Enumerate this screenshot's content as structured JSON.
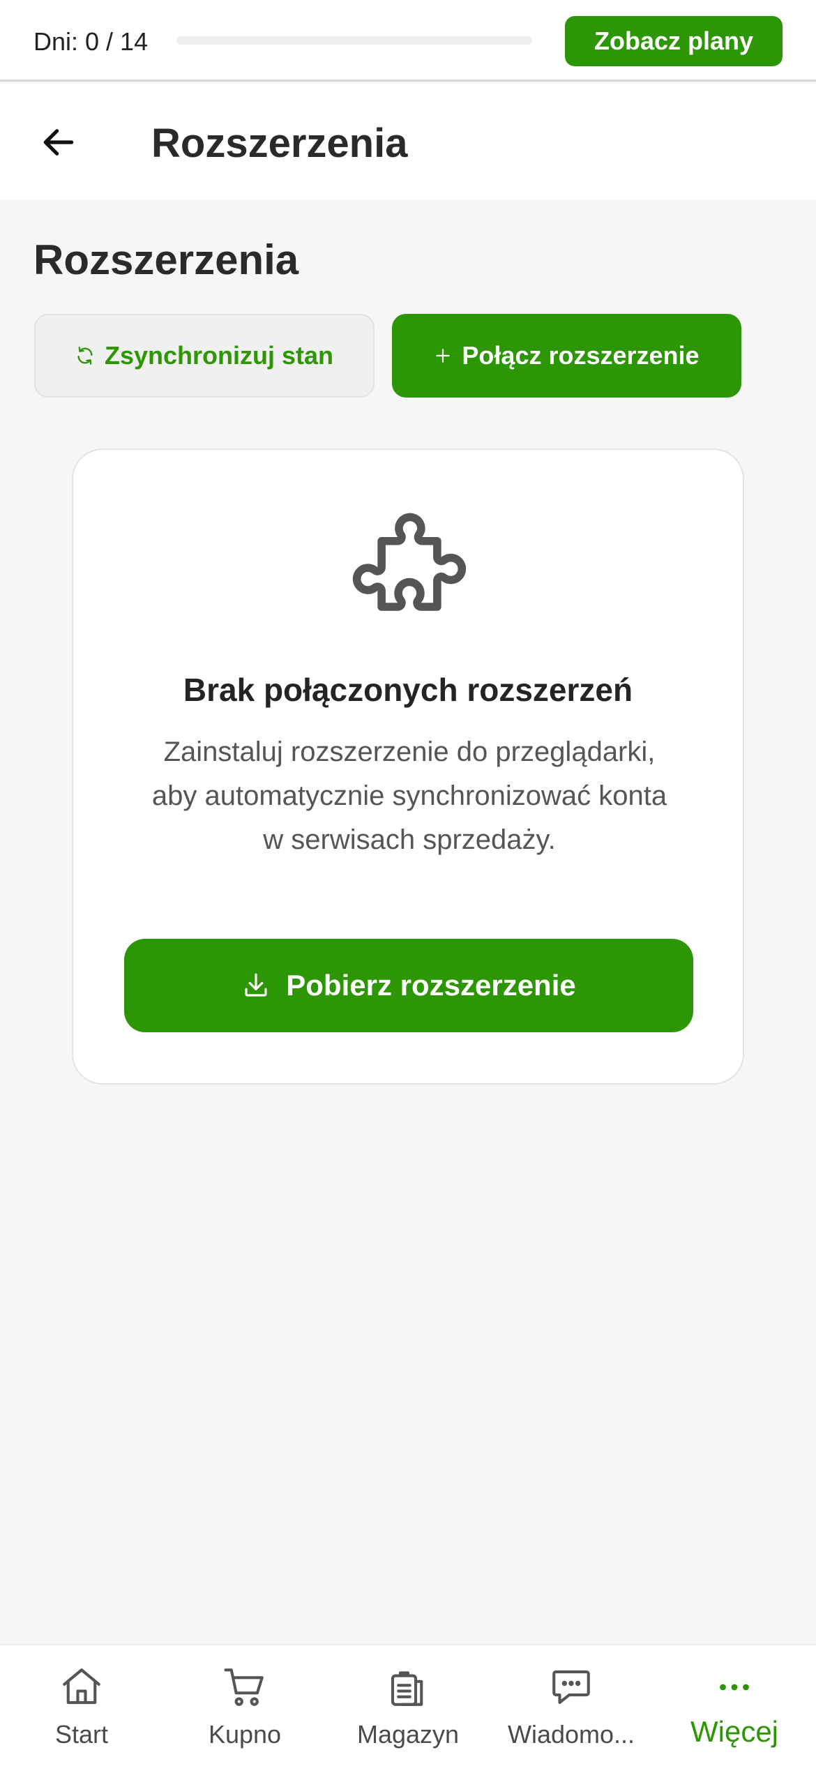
{
  "trial": {
    "days_label": "Dni: 0 / 14",
    "progress_fraction": 0,
    "plans_button": "Zobacz plany"
  },
  "header": {
    "back_icon": "arrow-left-icon",
    "title": "Rozszerzenia"
  },
  "section": {
    "title": "Rozszerzenia",
    "sync_button": "Zsynchronizuj stan",
    "connect_button": "Połącz rozszerzenie"
  },
  "empty_state": {
    "icon": "puzzle-icon",
    "title": "Brak połączonych rozszerzeń",
    "description": "Zainstaluj rozszerzenie do przeglądarki, aby automatycznie synchronizować konta w serwisach sprzedaży.",
    "download_button": "Pobierz rozszerzenie"
  },
  "nav": {
    "items": [
      {
        "label": "Start",
        "icon": "home-icon"
      },
      {
        "label": "Kupno",
        "icon": "cart-icon"
      },
      {
        "label": "Magazyn",
        "icon": "clipboard-icon"
      },
      {
        "label": "Wiadomo...",
        "icon": "chat-icon"
      },
      {
        "label": "Więcej",
        "icon": "more-icon"
      }
    ],
    "active_index": 4
  },
  "colors": {
    "accent": "#2d9605",
    "background": "#f6f6f6",
    "surface": "#ffffff",
    "text_primary": "#222222",
    "text_secondary": "#555555"
  }
}
